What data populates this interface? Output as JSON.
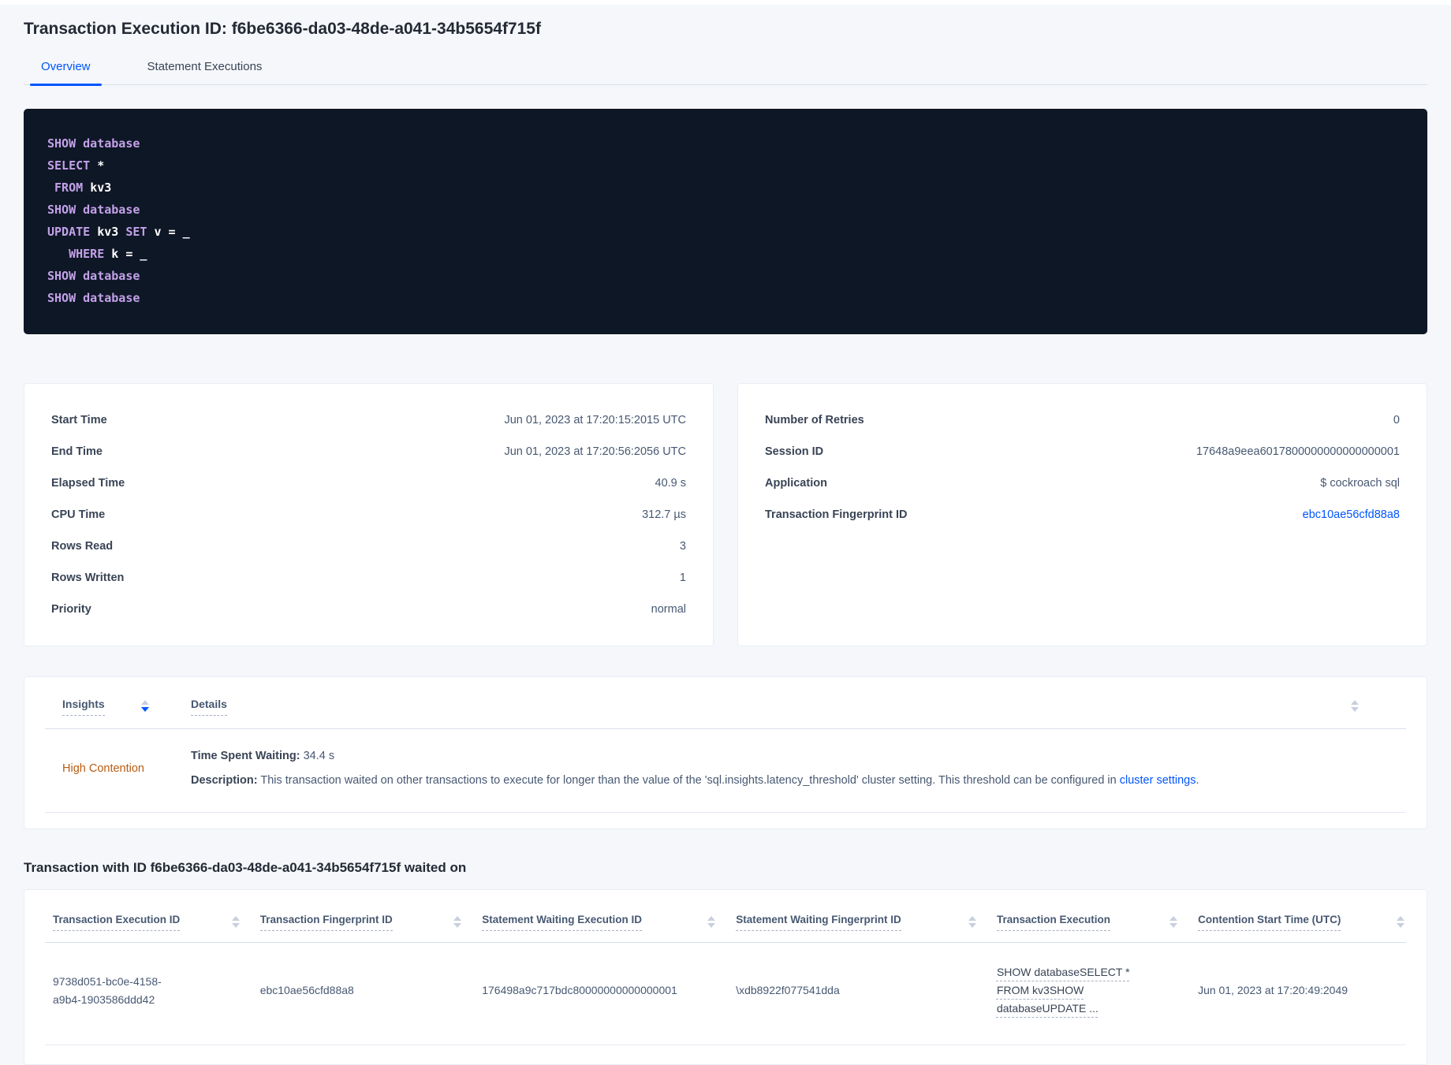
{
  "colors": {
    "accent_blue": "#0055ff",
    "high_contention_orange": "#b85c12",
    "code_background": "#0e1726",
    "code_keyword_purple": "#c3a1e8"
  },
  "header": {
    "title": "Transaction Execution ID: f6be6366-da03-48de-a041-34b5654f715f"
  },
  "tabs": [
    {
      "label": "Overview"
    },
    {
      "label": "Statement Executions"
    }
  ],
  "sql_box": {
    "lines": [
      [
        {
          "kw": true,
          "t": "SHOW database"
        }
      ],
      [
        {
          "kw": true,
          "t": "SELECT "
        },
        {
          "kw": false,
          "t": "*"
        }
      ],
      [
        {
          "kw": false,
          "t": " "
        },
        {
          "kw": true,
          "t": "FROM "
        },
        {
          "kw": false,
          "t": "kv3"
        }
      ],
      [
        {
          "kw": true,
          "t": "SHOW database"
        }
      ],
      [
        {
          "kw": true,
          "t": "UPDATE "
        },
        {
          "kw": false,
          "t": "kv3 "
        },
        {
          "kw": true,
          "t": "SET "
        },
        {
          "kw": false,
          "t": "v = _"
        }
      ],
      [
        {
          "kw": false,
          "t": "   "
        },
        {
          "kw": true,
          "t": "WHERE "
        },
        {
          "kw": false,
          "t": "k = _"
        }
      ],
      [
        {
          "kw": true,
          "t": "SHOW database"
        }
      ],
      [
        {
          "kw": true,
          "t": "SHOW database"
        }
      ]
    ]
  },
  "stats_left": {
    "rows": [
      {
        "label": "Start Time",
        "value": "Jun 01, 2023 at 17:20:15:2015 UTC"
      },
      {
        "label": "End Time",
        "value": "Jun 01, 2023 at 17:20:56:2056 UTC"
      },
      {
        "label": "Elapsed Time",
        "value": "40.9 s"
      },
      {
        "label": "CPU Time",
        "value": "312.7 µs"
      },
      {
        "label": "Rows Read",
        "value": "3"
      },
      {
        "label": "Rows Written",
        "value": "1"
      },
      {
        "label": "Priority",
        "value": "normal"
      }
    ]
  },
  "stats_right": {
    "rows": [
      {
        "label": "Number of Retries",
        "value": "0"
      },
      {
        "label": "Session ID",
        "value": "17648a9eea6017800000000000000001"
      },
      {
        "label": "Application",
        "value": "$ cockroach sql"
      },
      {
        "label": "Transaction Fingerprint ID",
        "value": "ebc10ae56cfd88a8"
      }
    ]
  },
  "insights": {
    "columns": {
      "insights": "Insights",
      "details": "Details"
    },
    "row": {
      "insight": "High Contention",
      "waiting_label": "Time Spent Waiting:",
      "waiting_value": " 34.4 s",
      "description_label": "Description:",
      "description_text": " This transaction waited on other transactions to execute for longer than the value of the 'sql.insights.latency_threshold' cluster setting. This threshold can be configured in ",
      "description_link": "cluster settings",
      "description_suffix": "."
    }
  },
  "waited_section": {
    "heading": "Transaction with ID f6be6366-da03-48de-a041-34b5654f715f waited on",
    "columns": [
      "Transaction Execution ID",
      "Transaction Fingerprint ID",
      "Statement Waiting Execution ID",
      "Statement Waiting Fingerprint ID",
      "Transaction Execution",
      "Contention Start Time (UTC)"
    ],
    "row": {
      "transaction_execution_id": "9738d051-bc0e-4158-a9b4-1903586ddd42",
      "transaction_fingerprint_id": "ebc10ae56cfd88a8",
      "statement_waiting_execution_id": "176498a9c717bdc80000000000000001",
      "statement_waiting_fingerprint_id": "\\xdb8922f077541dda",
      "transaction_execution": "SHOW databaseSELECT * FROM kv3SHOW databaseUPDATE ...",
      "contention_start_time": "Jun 01, 2023 at 17:20:49:2049"
    }
  }
}
